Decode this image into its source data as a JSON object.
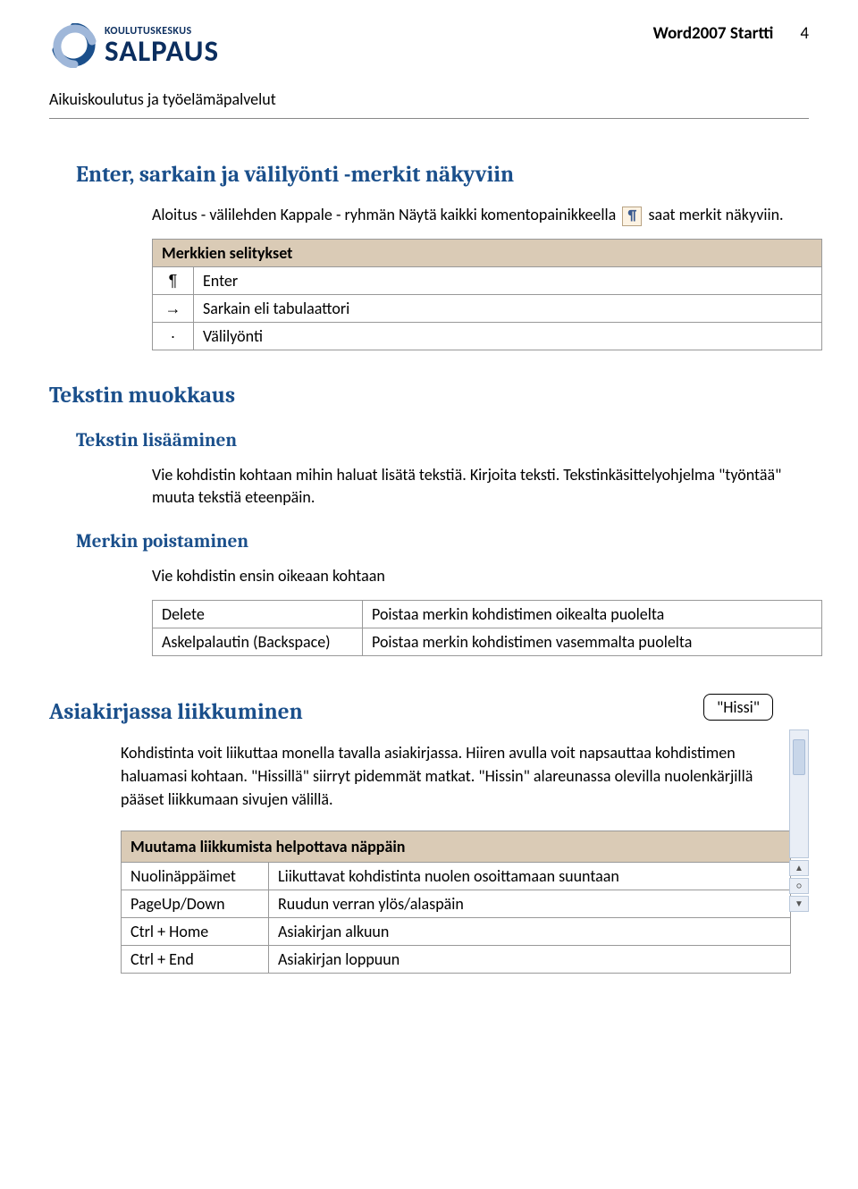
{
  "header": {
    "logo_small": "KOULUTUSKESKUS",
    "logo_big": "SALPAUS",
    "doc_title": "Word2007 Startti",
    "page_number": "4",
    "sub": "Aikuiskoulutus ja työelämäpalvelut"
  },
  "s1": {
    "heading": "Enter, sarkain ja välilyönti -merkit näkyviin",
    "intro_a": "Aloitus - välilehden Kappale - ryhmän Näytä kaikki komentopainikkeella ",
    "intro_b": " saat merkit näkyviin.",
    "pilcrow": "¶",
    "table": {
      "title": "Merkkien selitykset",
      "rows": [
        {
          "sym": "¶",
          "text": "Enter"
        },
        {
          "sym": "→",
          "text": "Sarkain eli tabulaattori"
        },
        {
          "sym": "·",
          "text": "Välilyönti"
        }
      ]
    }
  },
  "s2": {
    "heading": "Tekstin muokkaus",
    "sub1": "Tekstin lisääminen",
    "body1": "Vie kohdistin kohtaan mihin haluat lisätä tekstiä. Kirjoita teksti. Tekstinkäsittelyohjelma \"työntää\" muuta tekstiä eteenpäin.",
    "sub2": "Merkin poistaminen",
    "body2": "Vie kohdistin ensin oikeaan kohtaan",
    "del_rows": [
      {
        "k": "Delete",
        "v": "Poistaa merkin kohdistimen oikealta puolelta"
      },
      {
        "k": "Askelpalautin (Backspace)",
        "v": "Poistaa merkin kohdistimen vasemmalta puolelta"
      }
    ]
  },
  "s3": {
    "heading": "Asiakirjassa liikkuminen",
    "callout": "\"Hissi\"",
    "body": "Kohdistinta voit liikuttaa monella tavalla asiakirjassa. Hiiren avulla voit napsauttaa kohdistimen haluamasi kohtaan. \"Hissillä\" siirryt pidemmät matkat. \"Hissin\" alareunassa olevilla nuolenkärjillä pääset liikkumaan sivujen välillä.",
    "nav_title": "Muutama liikkumista helpottava näppäin",
    "nav_rows": [
      {
        "k": "Nuolinäppäimet",
        "v": "Liikuttavat kohdistinta nuolen osoittamaan suuntaan"
      },
      {
        "k": "PageUp/Down",
        "v": "Ruudun verran ylös/alaspäin"
      },
      {
        "k": "Ctrl + Home",
        "v": "Asiakirjan alkuun"
      },
      {
        "k": "Ctrl + End",
        "v": "Asiakirjan loppuun"
      }
    ]
  }
}
